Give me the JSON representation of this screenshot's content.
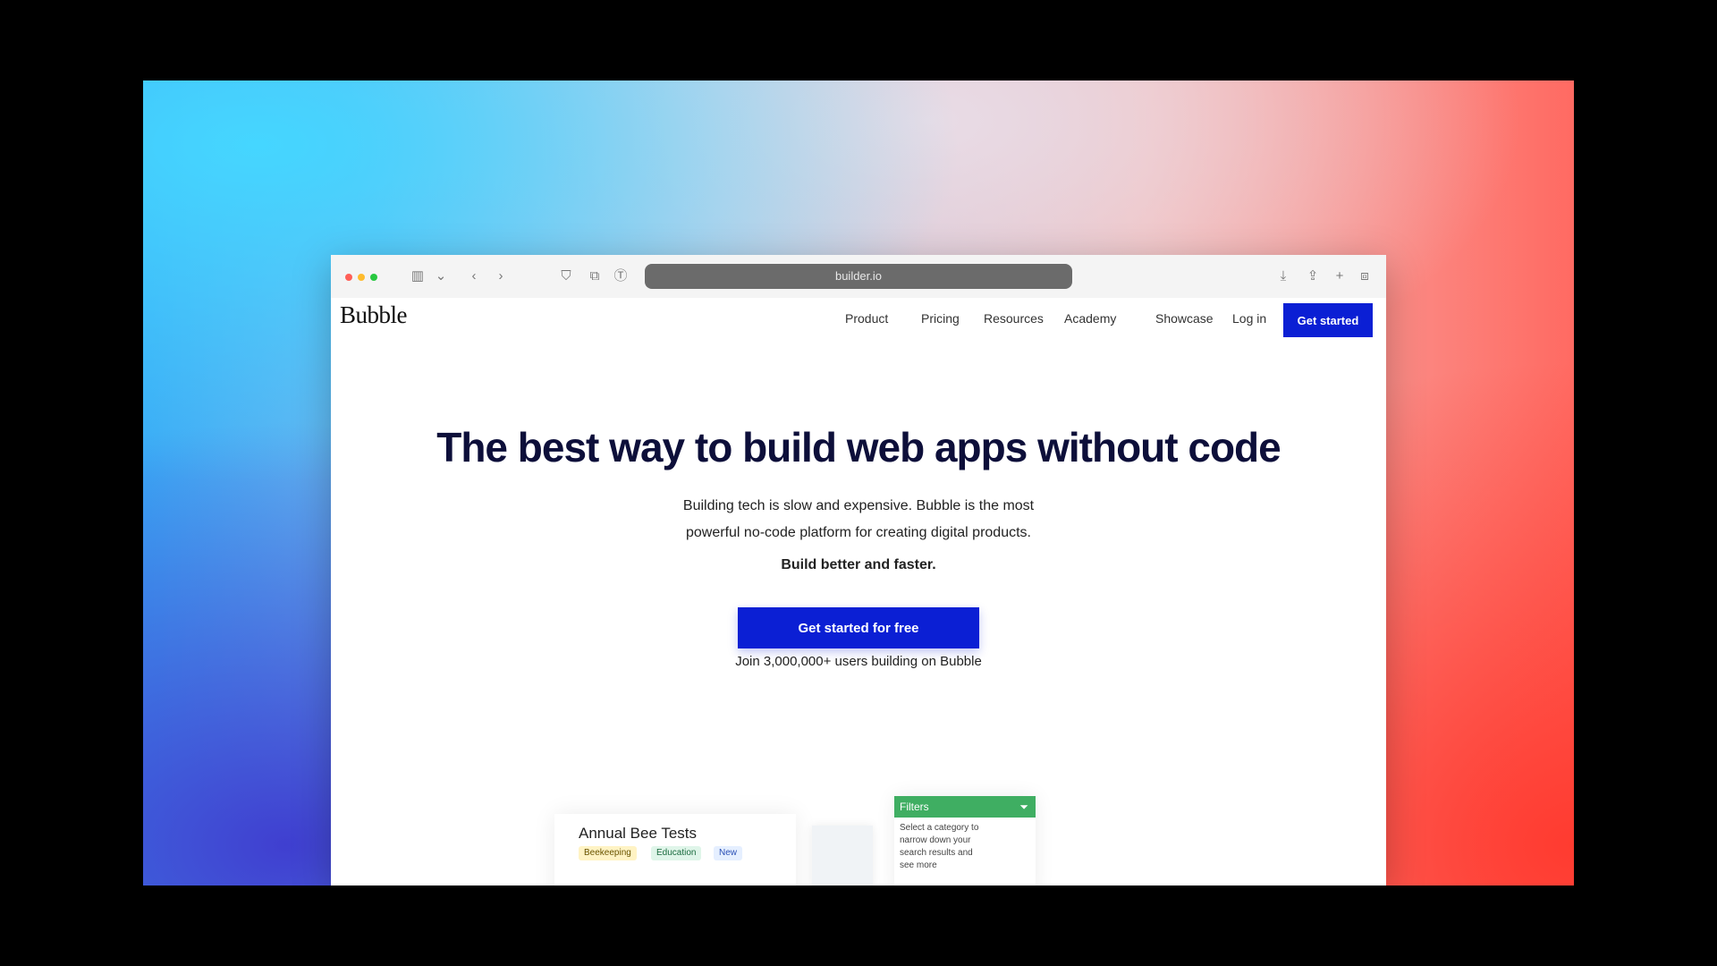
{
  "browser": {
    "url": "builder.io"
  },
  "site": {
    "logo": "Bubble",
    "nav": [
      "Product",
      "Pricing",
      "Resources",
      "Academy",
      "Showcase",
      "Log in"
    ],
    "top_cta": "Get started"
  },
  "hero": {
    "title": "The best way to build web apps without code",
    "subtitle_line1": "Building tech is slow and expensive. Bubble is the most",
    "subtitle_line2": "powerful no-code platform for creating digital products.",
    "subtitle_line3": "Build better and faster.",
    "cta": "Get started for free",
    "note": "Join 3,000,000+ users building on Bubble"
  },
  "preview": {
    "card1_title": "Annual Bee Tests",
    "card1_tags": [
      "Beekeeping",
      "Education",
      "New"
    ],
    "card3_header": "Filters",
    "card3_lines": [
      "Select a category to",
      "narrow down your",
      "search results and",
      "see more"
    ]
  }
}
